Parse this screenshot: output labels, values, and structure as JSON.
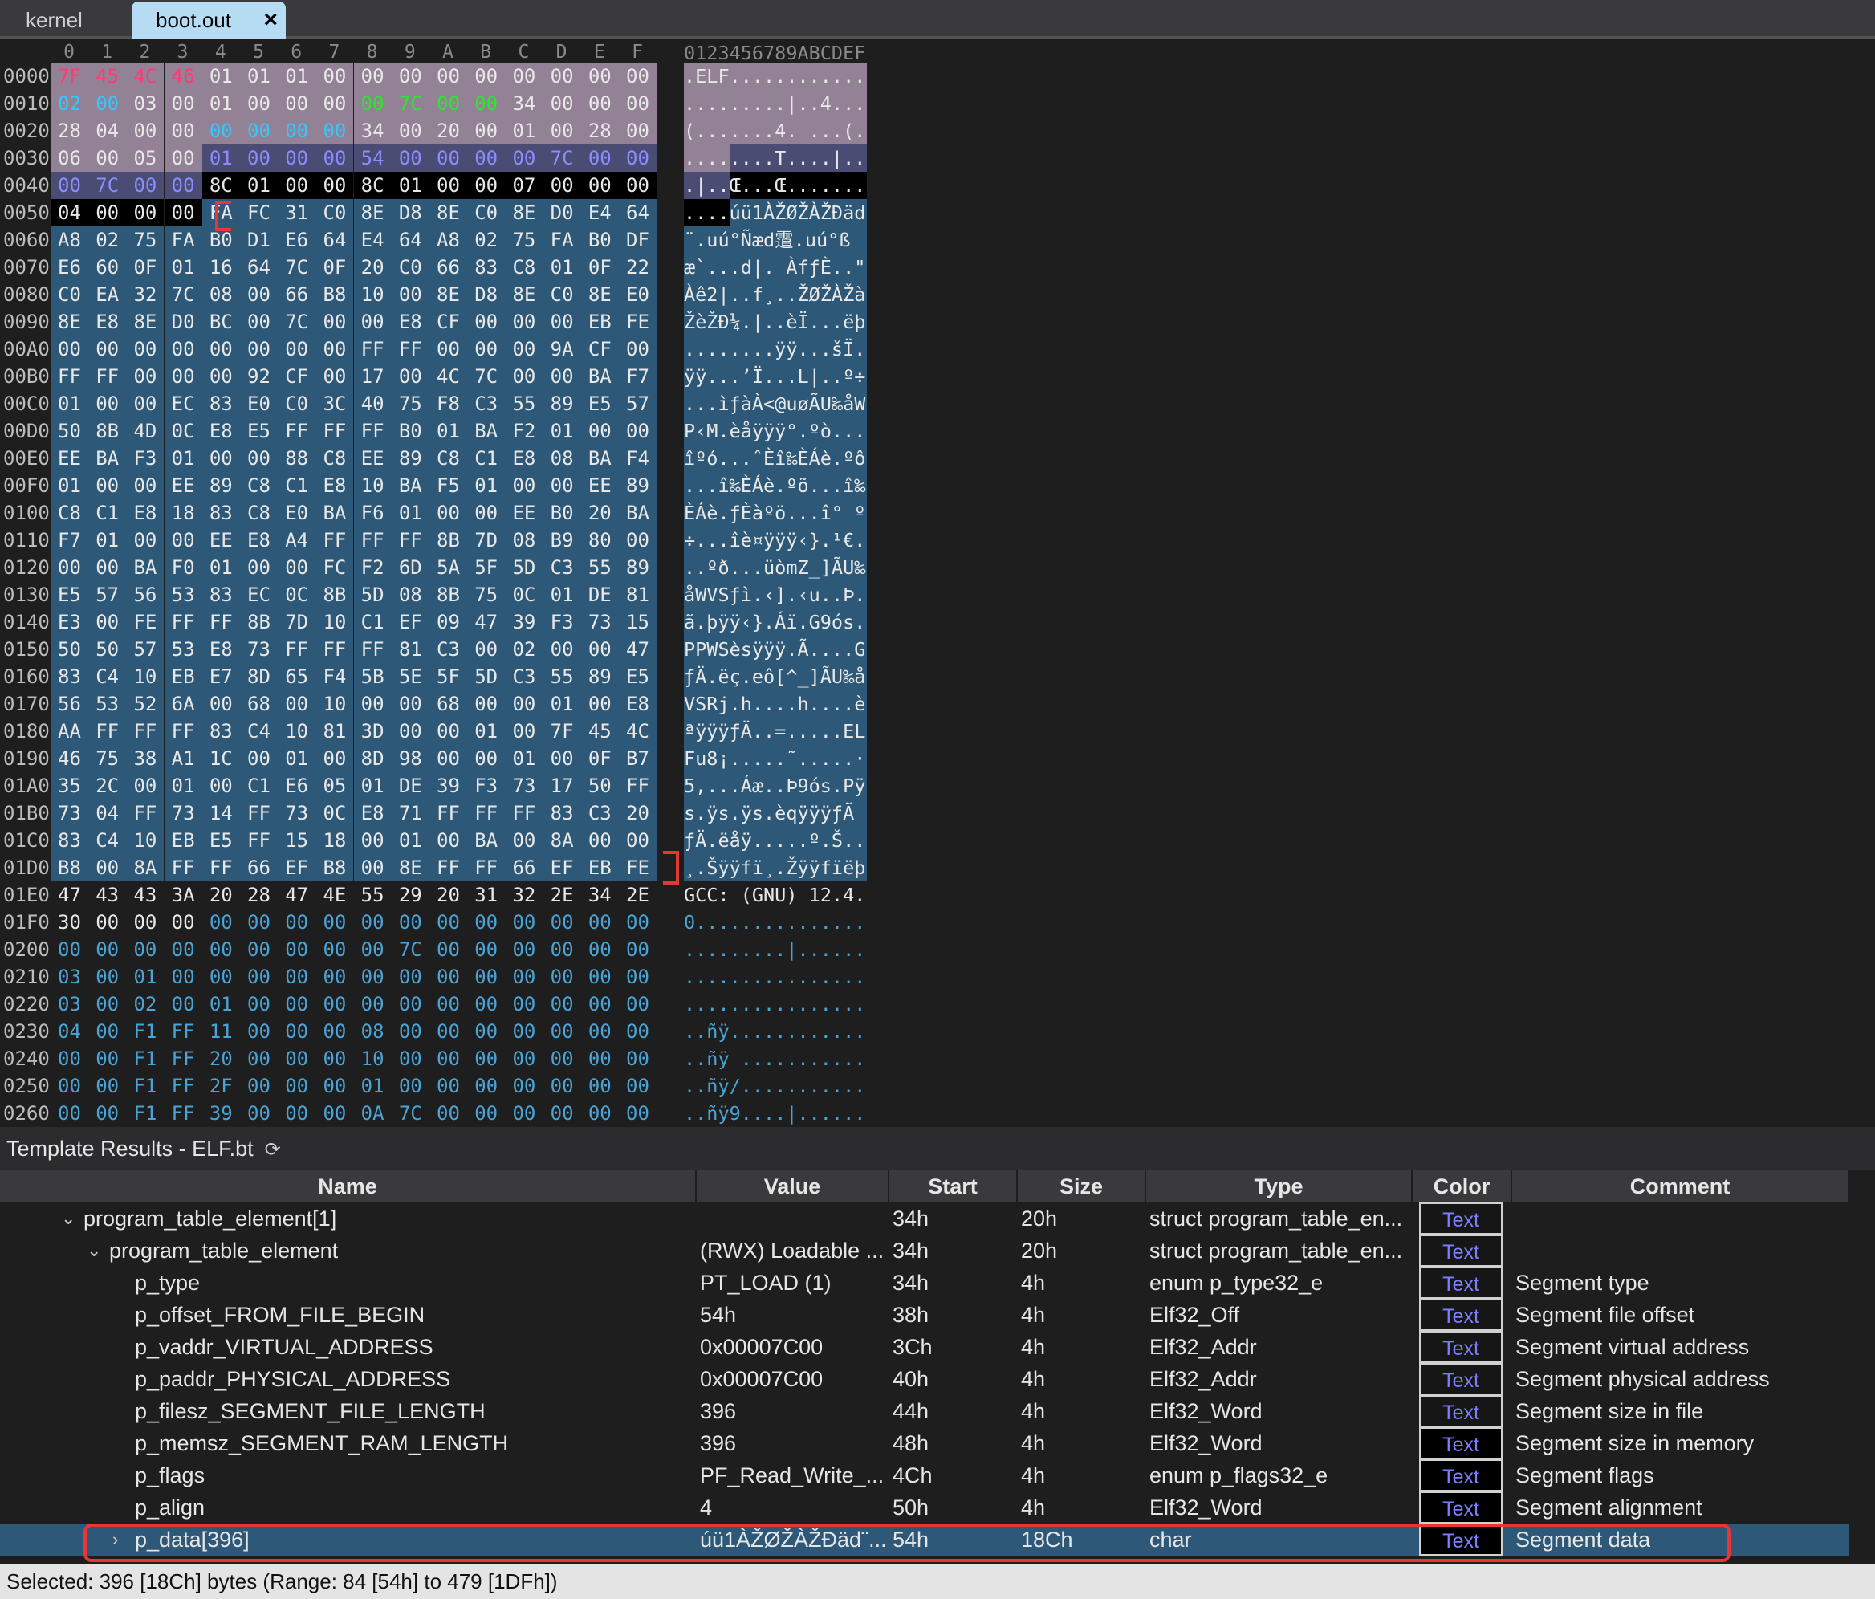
{
  "tabs": [
    {
      "label": "kernel",
      "active": false
    },
    {
      "label": "boot.out",
      "active": true,
      "close": "×"
    }
  ],
  "hex": {
    "column_headers": [
      "0",
      "1",
      "2",
      "3",
      "4",
      "5",
      "6",
      "7",
      "8",
      "9",
      "A",
      "B",
      "C",
      "D",
      "E",
      "F"
    ],
    "ascii_header": "0123456789ABCDEF",
    "rows": [
      {
        "offset": "0000",
        "bytes": [
          "7F",
          "45",
          "4C",
          "46",
          "01",
          "01",
          "01",
          "00",
          "00",
          "00",
          "00",
          "00",
          "00",
          "00",
          "00",
          "00"
        ],
        "ascii": ".ELF............"
      },
      {
        "offset": "0010",
        "bytes": [
          "02",
          "00",
          "03",
          "00",
          "01",
          "00",
          "00",
          "00",
          "00",
          "7C",
          "00",
          "00",
          "34",
          "00",
          "00",
          "00"
        ],
        "ascii": ".........|..4..."
      },
      {
        "offset": "0020",
        "bytes": [
          "28",
          "04",
          "00",
          "00",
          "00",
          "00",
          "00",
          "00",
          "34",
          "00",
          "20",
          "00",
          "01",
          "00",
          "28",
          "00"
        ],
        "ascii": "(.......4. ...(."
      },
      {
        "offset": "0030",
        "bytes": [
          "06",
          "00",
          "05",
          "00",
          "01",
          "00",
          "00",
          "00",
          "54",
          "00",
          "00",
          "00",
          "00",
          "7C",
          "00",
          "00"
        ],
        "ascii": "........T....|.."
      },
      {
        "offset": "0040",
        "bytes": [
          "00",
          "7C",
          "00",
          "00",
          "8C",
          "01",
          "00",
          "00",
          "8C",
          "01",
          "00",
          "00",
          "07",
          "00",
          "00",
          "00"
        ],
        "ascii": ".|..Œ...Œ......."
      },
      {
        "offset": "0050",
        "bytes": [
          "04",
          "00",
          "00",
          "00",
          "FA",
          "FC",
          "31",
          "C0",
          "8E",
          "D8",
          "8E",
          "C0",
          "8E",
          "D0",
          "E4",
          "64"
        ],
        "ascii": "....úü1ÀŽØŽÀŽÐäd"
      },
      {
        "offset": "0060",
        "bytes": [
          "A8",
          "02",
          "75",
          "FA",
          "B0",
          "D1",
          "E6",
          "64",
          "E4",
          "64",
          "A8",
          "02",
          "75",
          "FA",
          "B0",
          "DF"
        ],
        "ascii": "¨.uú°Ñæd䨨.uú°ß"
      },
      {
        "offset": "0070",
        "bytes": [
          "E6",
          "60",
          "0F",
          "01",
          "16",
          "64",
          "7C",
          "0F",
          "20",
          "C0",
          "66",
          "83",
          "C8",
          "01",
          "0F",
          "22"
        ],
        "ascii": "æ`...d|. ÀfƒÈ..\""
      },
      {
        "offset": "0080",
        "bytes": [
          "C0",
          "EA",
          "32",
          "7C",
          "08",
          "00",
          "66",
          "B8",
          "10",
          "00",
          "8E",
          "D8",
          "8E",
          "C0",
          "8E",
          "E0"
        ],
        "ascii": "Àê2|..f¸..ŽØŽÀŽà"
      },
      {
        "offset": "0090",
        "bytes": [
          "8E",
          "E8",
          "8E",
          "D0",
          "BC",
          "00",
          "7C",
          "00",
          "00",
          "E8",
          "CF",
          "00",
          "00",
          "00",
          "EB",
          "FE"
        ],
        "ascii": "ŽèŽÐ¼.|..èÏ...ëþ"
      },
      {
        "offset": "00A0",
        "bytes": [
          "00",
          "00",
          "00",
          "00",
          "00",
          "00",
          "00",
          "00",
          "FF",
          "FF",
          "00",
          "00",
          "00",
          "9A",
          "CF",
          "00"
        ],
        "ascii": "........ÿÿ...šÏ."
      },
      {
        "offset": "00B0",
        "bytes": [
          "FF",
          "FF",
          "00",
          "00",
          "00",
          "92",
          "CF",
          "00",
          "17",
          "00",
          "4C",
          "7C",
          "00",
          "00",
          "BA",
          "F7"
        ],
        "ascii": "ÿÿ...’Ï...L|..º÷"
      },
      {
        "offset": "00C0",
        "bytes": [
          "01",
          "00",
          "00",
          "EC",
          "83",
          "E0",
          "C0",
          "3C",
          "40",
          "75",
          "F8",
          "C3",
          "55",
          "89",
          "E5",
          "57"
        ],
        "ascii": "...ìƒàÀ<@uøÃU‰åW"
      },
      {
        "offset": "00D0",
        "bytes": [
          "50",
          "8B",
          "4D",
          "0C",
          "E8",
          "E5",
          "FF",
          "FF",
          "FF",
          "B0",
          "01",
          "BA",
          "F2",
          "01",
          "00",
          "00"
        ],
        "ascii": "P‹M.èåÿÿÿ°.ºò..."
      },
      {
        "offset": "00E0",
        "bytes": [
          "EE",
          "BA",
          "F3",
          "01",
          "00",
          "00",
          "88",
          "C8",
          "EE",
          "89",
          "C8",
          "C1",
          "E8",
          "08",
          "BA",
          "F4"
        ],
        "ascii": "îºó...ˆÈî‰ÈÁè.ºô"
      },
      {
        "offset": "00F0",
        "bytes": [
          "01",
          "00",
          "00",
          "EE",
          "89",
          "C8",
          "C1",
          "E8",
          "10",
          "BA",
          "F5",
          "01",
          "00",
          "00",
          "EE",
          "89"
        ],
        "ascii": "...î‰ÈÁè.ºõ...î‰"
      },
      {
        "offset": "0100",
        "bytes": [
          "C8",
          "C1",
          "E8",
          "18",
          "83",
          "C8",
          "E0",
          "BA",
          "F6",
          "01",
          "00",
          "00",
          "EE",
          "B0",
          "20",
          "BA"
        ],
        "ascii": "ÈÁè.ƒÈàºö...î° º"
      },
      {
        "offset": "0110",
        "bytes": [
          "F7",
          "01",
          "00",
          "00",
          "EE",
          "E8",
          "A4",
          "FF",
          "FF",
          "FF",
          "8B",
          "7D",
          "08",
          "B9",
          "80",
          "00"
        ],
        "ascii": "÷...îè¤ÿÿÿ‹}.¹€."
      },
      {
        "offset": "0120",
        "bytes": [
          "00",
          "00",
          "BA",
          "F0",
          "01",
          "00",
          "00",
          "FC",
          "F2",
          "6D",
          "5A",
          "5F",
          "5D",
          "C3",
          "55",
          "89"
        ],
        "ascii": "..ºð...üòmZ_]ÃU‰"
      },
      {
        "offset": "0130",
        "bytes": [
          "E5",
          "57",
          "56",
          "53",
          "83",
          "EC",
          "0C",
          "8B",
          "5D",
          "08",
          "8B",
          "75",
          "0C",
          "01",
          "DE",
          "81"
        ],
        "ascii": "åWVSƒì.‹].‹u..Þ."
      },
      {
        "offset": "0140",
        "bytes": [
          "E3",
          "00",
          "FE",
          "FF",
          "FF",
          "8B",
          "7D",
          "10",
          "C1",
          "EF",
          "09",
          "47",
          "39",
          "F3",
          "73",
          "15"
        ],
        "ascii": "ã.þÿÿ‹}.Áï.G9ós."
      },
      {
        "offset": "0150",
        "bytes": [
          "50",
          "50",
          "57",
          "53",
          "E8",
          "73",
          "FF",
          "FF",
          "FF",
          "81",
          "C3",
          "00",
          "02",
          "00",
          "00",
          "47"
        ],
        "ascii": "PPWSèsÿÿÿ.Ã....G"
      },
      {
        "offset": "0160",
        "bytes": [
          "83",
          "C4",
          "10",
          "EB",
          "E7",
          "8D",
          "65",
          "F4",
          "5B",
          "5E",
          "5F",
          "5D",
          "C3",
          "55",
          "89",
          "E5"
        ],
        "ascii": "ƒÄ.ëç.eô[^_]ÃU‰å"
      },
      {
        "offset": "0170",
        "bytes": [
          "56",
          "53",
          "52",
          "6A",
          "00",
          "68",
          "00",
          "10",
          "00",
          "00",
          "68",
          "00",
          "00",
          "01",
          "00",
          "E8"
        ],
        "ascii": "VSRj.h....h....è"
      },
      {
        "offset": "0180",
        "bytes": [
          "AA",
          "FF",
          "FF",
          "FF",
          "83",
          "C4",
          "10",
          "81",
          "3D",
          "00",
          "00",
          "01",
          "00",
          "7F",
          "45",
          "4C"
        ],
        "ascii": "ªÿÿÿƒÄ..=.....EL"
      },
      {
        "offset": "0190",
        "bytes": [
          "46",
          "75",
          "38",
          "A1",
          "1C",
          "00",
          "01",
          "00",
          "8D",
          "98",
          "00",
          "00",
          "01",
          "00",
          "0F",
          "B7"
        ],
        "ascii": "Fu8¡.....˜.....·"
      },
      {
        "offset": "01A0",
        "bytes": [
          "35",
          "2C",
          "00",
          "01",
          "00",
          "C1",
          "E6",
          "05",
          "01",
          "DE",
          "39",
          "F3",
          "73",
          "17",
          "50",
          "FF"
        ],
        "ascii": "5,...Áæ..Þ9ós.Pÿ"
      },
      {
        "offset": "01B0",
        "bytes": [
          "73",
          "04",
          "FF",
          "73",
          "14",
          "FF",
          "73",
          "0C",
          "E8",
          "71",
          "FF",
          "FF",
          "FF",
          "83",
          "C3",
          "20"
        ],
        "ascii": "s.ÿs.ÿs.èqÿÿÿƒÃ "
      },
      {
        "offset": "01C0",
        "bytes": [
          "83",
          "C4",
          "10",
          "EB",
          "E5",
          "FF",
          "15",
          "18",
          "00",
          "01",
          "00",
          "BA",
          "00",
          "8A",
          "00",
          "00"
        ],
        "ascii": "ƒÄ.ëåÿ.....º.Š.."
      },
      {
        "offset": "01D0",
        "bytes": [
          "B8",
          "00",
          "8A",
          "FF",
          "FF",
          "66",
          "EF",
          "B8",
          "00",
          "8E",
          "FF",
          "FF",
          "66",
          "EF",
          "EB",
          "FE"
        ],
        "ascii": "¸.Šÿÿfï¸.Žÿÿfïëþ"
      },
      {
        "offset": "01E0",
        "bytes": [
          "47",
          "43",
          "43",
          "3A",
          "20",
          "28",
          "47",
          "4E",
          "55",
          "29",
          "20",
          "31",
          "32",
          "2E",
          "34",
          "2E"
        ],
        "ascii": "GCC: (GNU) 12.4."
      },
      {
        "offset": "01F0",
        "bytes": [
          "30",
          "00",
          "00",
          "00",
          "00",
          "00",
          "00",
          "00",
          "00",
          "00",
          "00",
          "00",
          "00",
          "00",
          "00",
          "00"
        ],
        "ascii": "0..............."
      },
      {
        "offset": "0200",
        "bytes": [
          "00",
          "00",
          "00",
          "00",
          "00",
          "00",
          "00",
          "00",
          "00",
          "7C",
          "00",
          "00",
          "00",
          "00",
          "00",
          "00"
        ],
        "ascii": ".........|......"
      },
      {
        "offset": "0210",
        "bytes": [
          "03",
          "00",
          "01",
          "00",
          "00",
          "00",
          "00",
          "00",
          "00",
          "00",
          "00",
          "00",
          "00",
          "00",
          "00",
          "00"
        ],
        "ascii": "................"
      },
      {
        "offset": "0220",
        "bytes": [
          "03",
          "00",
          "02",
          "00",
          "01",
          "00",
          "00",
          "00",
          "00",
          "00",
          "00",
          "00",
          "00",
          "00",
          "00",
          "00"
        ],
        "ascii": "................"
      },
      {
        "offset": "0230",
        "bytes": [
          "04",
          "00",
          "F1",
          "FF",
          "11",
          "00",
          "00",
          "00",
          "08",
          "00",
          "00",
          "00",
          "00",
          "00",
          "00",
          "00"
        ],
        "ascii": "..ñÿ............"
      },
      {
        "offset": "0240",
        "bytes": [
          "00",
          "00",
          "F1",
          "FF",
          "20",
          "00",
          "00",
          "00",
          "10",
          "00",
          "00",
          "00",
          "00",
          "00",
          "00",
          "00"
        ],
        "ascii": "..ñÿ ..........."
      },
      {
        "offset": "0250",
        "bytes": [
          "00",
          "00",
          "F1",
          "FF",
          "2F",
          "00",
          "00",
          "00",
          "01",
          "00",
          "00",
          "00",
          "00",
          "00",
          "00",
          "00"
        ],
        "ascii": "..ñÿ/..........."
      },
      {
        "offset": "0260",
        "bytes": [
          "00",
          "00",
          "F1",
          "FF",
          "39",
          "00",
          "00",
          "00",
          "0A",
          "7C",
          "00",
          "00",
          "00",
          "00",
          "00",
          "00"
        ],
        "ascii": "..ñÿ9....|......"
      }
    ]
  },
  "template_results": {
    "title": "Template Results - ELF.bt",
    "refresh_icon": "refresh-icon",
    "columns": [
      "Name",
      "Value",
      "Start",
      "Size",
      "Type",
      "Color",
      "Comment"
    ],
    "rows": [
      {
        "indent": 1,
        "expander": "⌄",
        "name": "program_table_element[1]",
        "value": "",
        "start": "34h",
        "size": "20h",
        "type": "struct program_table_en...",
        "color": "Text",
        "comment": ""
      },
      {
        "indent": 2,
        "expander": "⌄",
        "name": "program_table_element",
        "value": "(RWX) Loadable ...",
        "start": "34h",
        "size": "20h",
        "type": "struct program_table_en...",
        "color": "Text",
        "comment": ""
      },
      {
        "indent": 3,
        "expander": "",
        "name": "p_type",
        "value": "PT_LOAD (1)",
        "start": "34h",
        "size": "4h",
        "type": "enum p_type32_e",
        "color": "Text",
        "comment": "Segment type"
      },
      {
        "indent": 3,
        "expander": "",
        "name": "p_offset_FROM_FILE_BEGIN",
        "value": "54h",
        "start": "38h",
        "size": "4h",
        "type": "Elf32_Off",
        "color": "Text",
        "comment": "Segment file offset"
      },
      {
        "indent": 3,
        "expander": "",
        "name": "p_vaddr_VIRTUAL_ADDRESS",
        "value": "0x00007C00",
        "start": "3Ch",
        "size": "4h",
        "type": "Elf32_Addr",
        "color": "Text",
        "comment": "Segment virtual address"
      },
      {
        "indent": 3,
        "expander": "",
        "name": "p_paddr_PHYSICAL_ADDRESS",
        "value": "0x00007C00",
        "start": "40h",
        "size": "4h",
        "type": "Elf32_Addr",
        "color": "Text",
        "comment": "Segment physical address"
      },
      {
        "indent": 3,
        "expander": "",
        "name": "p_filesz_SEGMENT_FILE_LENGTH",
        "value": "396",
        "start": "44h",
        "size": "4h",
        "type": "Elf32_Word",
        "color": "Text",
        "comment": "Segment size in file"
      },
      {
        "indent": 3,
        "expander": "",
        "name": "p_memsz_SEGMENT_RAM_LENGTH",
        "value": "396",
        "start": "48h",
        "size": "4h",
        "type": "Elf32_Word",
        "color": "Text",
        "comment": "Segment size in memory"
      },
      {
        "indent": 3,
        "expander": "",
        "name": "p_flags",
        "value": "PF_Read_Write_...",
        "start": "4Ch",
        "size": "4h",
        "type": "enum p_flags32_e",
        "color": "Text",
        "comment": "Segment flags"
      },
      {
        "indent": 3,
        "expander": "",
        "name": "p_align",
        "value": "4",
        "start": "50h",
        "size": "4h",
        "type": "Elf32_Word",
        "color": "Text",
        "comment": "Segment alignment"
      },
      {
        "indent": 3,
        "expander": "›",
        "name": "p_data[396]",
        "value": "úü1ÀŽØŽÀŽÐäd¨...",
        "start": "54h",
        "size": "18Ch",
        "type": "char",
        "color": "Text",
        "comment": "Segment data"
      }
    ]
  },
  "status": "Selected: 396 [18Ch] bytes (Range: 84 [54h] to 479 [1DFh])",
  "colors": {
    "selection_bg": "#2e5877",
    "elf_header_bg": "#938295",
    "program_header_bg": "#4b4c74",
    "magic_color": "#ff3a76",
    "cyan_color": "#33c8ff",
    "green_color": "#2ee62e",
    "blue_text": "#8a8cff",
    "annotation_red": "#e83535"
  }
}
